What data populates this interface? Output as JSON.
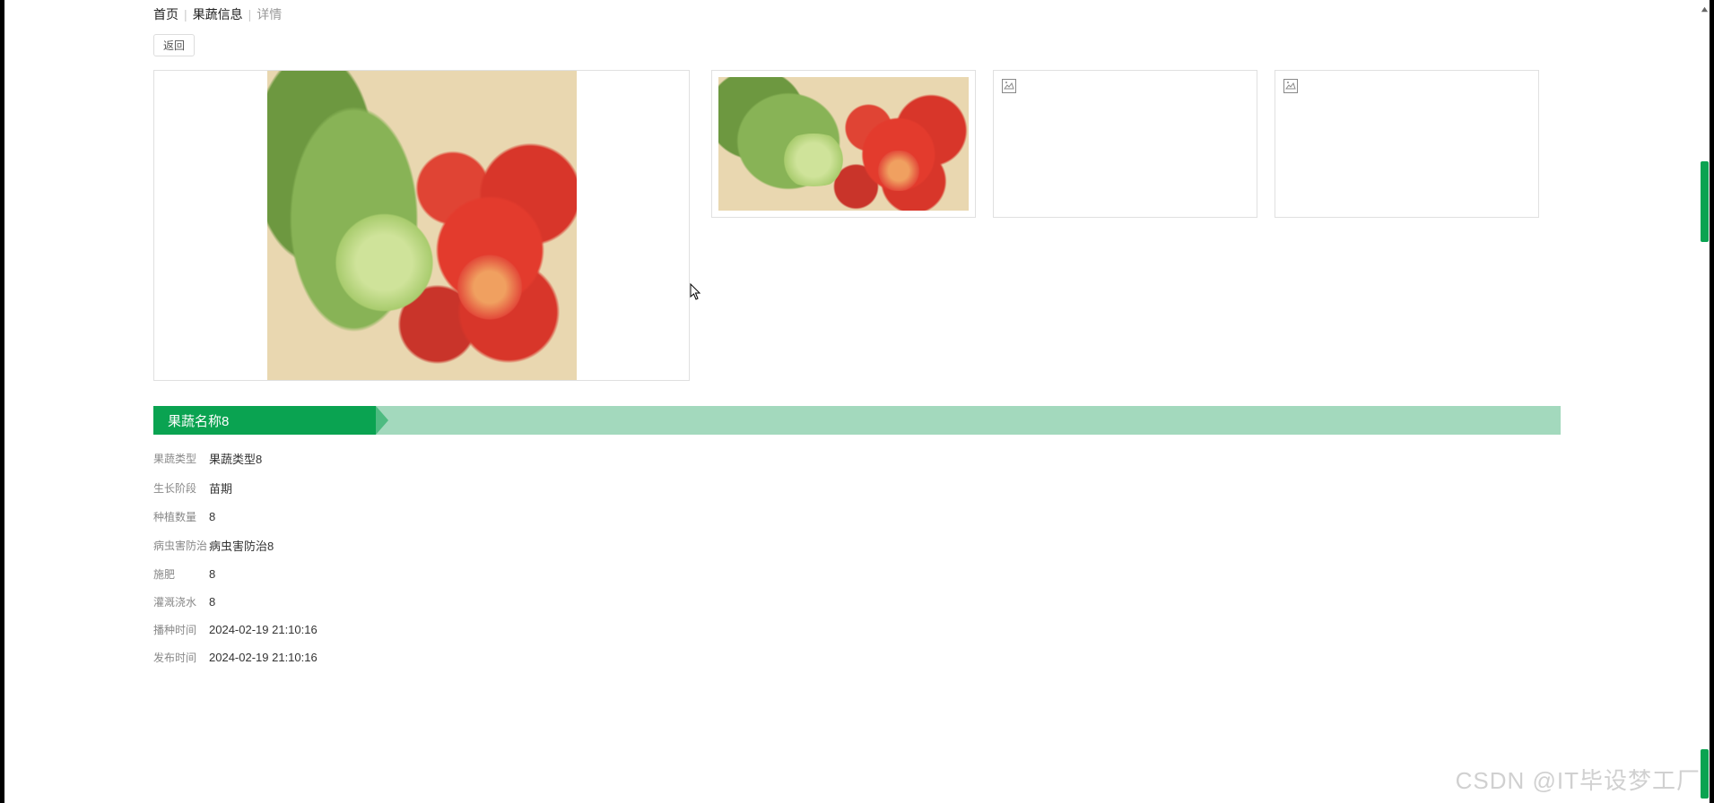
{
  "breadcrumb": {
    "home": "首页",
    "section": "果蔬信息",
    "current": "详情"
  },
  "buttons": {
    "back": "返回"
  },
  "title": "果蔬名称8",
  "details": [
    {
      "label": "果蔬类型",
      "value": "果蔬类型8"
    },
    {
      "label": "生长阶段",
      "value": "苗期"
    },
    {
      "label": "种植数量",
      "value": "8"
    },
    {
      "label": "病虫害防治",
      "value": "病虫害防治8"
    },
    {
      "label": "施肥",
      "value": "8"
    },
    {
      "label": "灌溉浇水",
      "value": "8"
    },
    {
      "label": "播种时间",
      "value": "2024-02-19 21:10:16"
    },
    {
      "label": "发布时间",
      "value": "2024-02-19 21:10:16"
    }
  ],
  "watermark": "CSDN @IT毕设梦工厂"
}
